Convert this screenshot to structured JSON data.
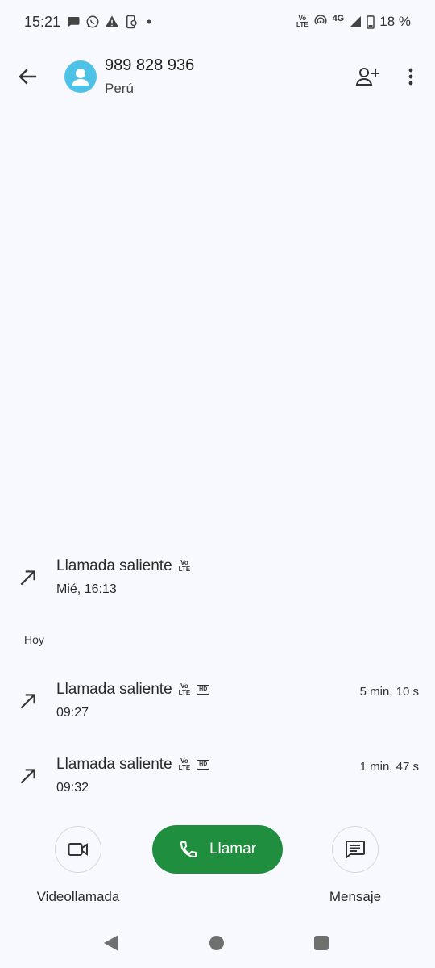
{
  "status_bar": {
    "time": "15:21",
    "network": "4G",
    "volte_line1": "Vo",
    "volte_line2": "LTE",
    "battery": "18 %",
    "left_icons": [
      "chat-bubble-icon",
      "whatsapp-icon",
      "warning-icon",
      "phone-sync-icon",
      "dot-icon"
    ],
    "right_icons": [
      "volte-icon",
      "hotspot-icon",
      "signal-icon",
      "battery-icon"
    ]
  },
  "header": {
    "number": "989 828 936",
    "country": "Perú",
    "avatar_color": "#4dc1e6"
  },
  "calls_earlier": [
    {
      "type": "Llamada saliente",
      "time": "Mié, 16:13",
      "duration": "",
      "hd": false
    }
  ],
  "section_today": "Hoy",
  "calls_today": [
    {
      "type": "Llamada saliente",
      "time": "09:27",
      "duration": "5 min, 10 s",
      "hd": true
    },
    {
      "type": "Llamada saliente",
      "time": "09:32",
      "duration": "1 min, 47 s",
      "hd": true
    }
  ],
  "badges": {
    "vo": "Vo",
    "lte": "LTE",
    "hd": "HD"
  },
  "actions": {
    "video_label": "Videollamada",
    "call_label": "Llamar",
    "message_label": "Mensaje",
    "call_color": "#1f8e3e"
  }
}
